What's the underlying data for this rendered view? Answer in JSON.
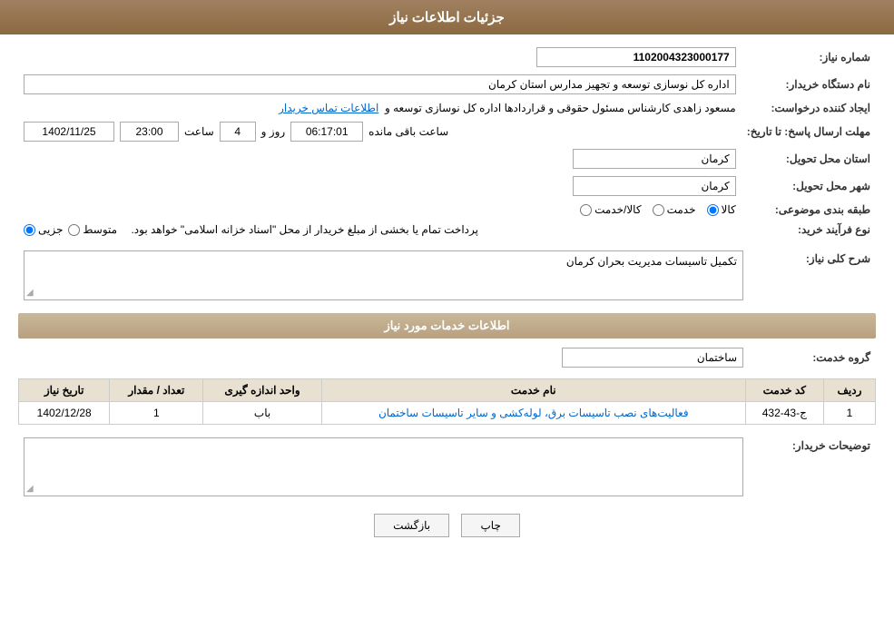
{
  "header": {
    "title": "جزئیات اطلاعات نیاز"
  },
  "fields": {
    "shomara_niaz_label": "شماره نیاز:",
    "shomara_niaz_value": "1102004323000177",
    "nam_dastgah_label": "نام دستگاه خریدار:",
    "nam_dastgah_value": "اداره کل نوسازی  توسعه و تجهیز مدارس استان کرمان",
    "ijad_konande_label": "ایجاد کننده درخواست:",
    "ijad_konande_value": "مسعود زاهدی کارشناس مسئول حقوقی و قراردادها اداره کل نوسازی  توسعه و",
    "ijad_konande_link": "اطلاعات تماس خریدار",
    "mohlat_label": "مهلت ارسال پاسخ: تا تاریخ:",
    "tarikh_value": "1402/11/25",
    "saat_label": "ساعت",
    "saat_value": "23:00",
    "roz_label": "روز و",
    "roz_value": "4",
    "baqi_saat_label": "ساعت باقی مانده",
    "baqi_saat_value": "06:17:01",
    "ostan_label": "استان محل تحویل:",
    "ostan_value": "کرمان",
    "shahr_label": "شهر محل تحویل:",
    "shahr_value": "کرمان",
    "tabaqe_label": "طبقه بندی موضوعی:",
    "tabaqe_options": [
      "کالا",
      "خدمت",
      "کالا/خدمت"
    ],
    "tabaqe_selected": "کالا",
    "nooe_farayand_label": "نوع فرآیند خرید:",
    "nooe_farayand_options": [
      "جزیی",
      "متوسط"
    ],
    "nooe_farayand_text": "پرداخت تمام یا بخشی از مبلغ خریدار از محل \"اسناد خزانه اسلامی\" خواهد بود.",
    "sharh_label": "شرح کلی نیاز:",
    "sharh_value": "تکمیل تاسیسات مدیریت بحران کرمان",
    "services_section_label": "اطلاعات خدمات مورد نیاز",
    "grohe_khedmat_label": "گروه خدمت:",
    "grohe_khedmat_value": "ساختمان",
    "table_headers": {
      "radif": "ردیف",
      "kod": "کد خدمت",
      "nam": "نام خدمت",
      "vahad": "واحد اندازه گیری",
      "tedad": "تعداد / مقدار",
      "tarikh": "تاریخ نیاز"
    },
    "table_rows": [
      {
        "radif": "1",
        "kod": "ج-43-432",
        "nam": "فعالیت‌های نصب تاسیسات برق، لوله‌کشی و سایر تاسیسات ساختمان",
        "vahad": "باب",
        "tedad": "1",
        "tarikh": "1402/12/28"
      }
    ],
    "tosihaat_label": "توضیحات خریدار:",
    "chap_label": "چاپ",
    "bazgasht_label": "بازگشت"
  }
}
